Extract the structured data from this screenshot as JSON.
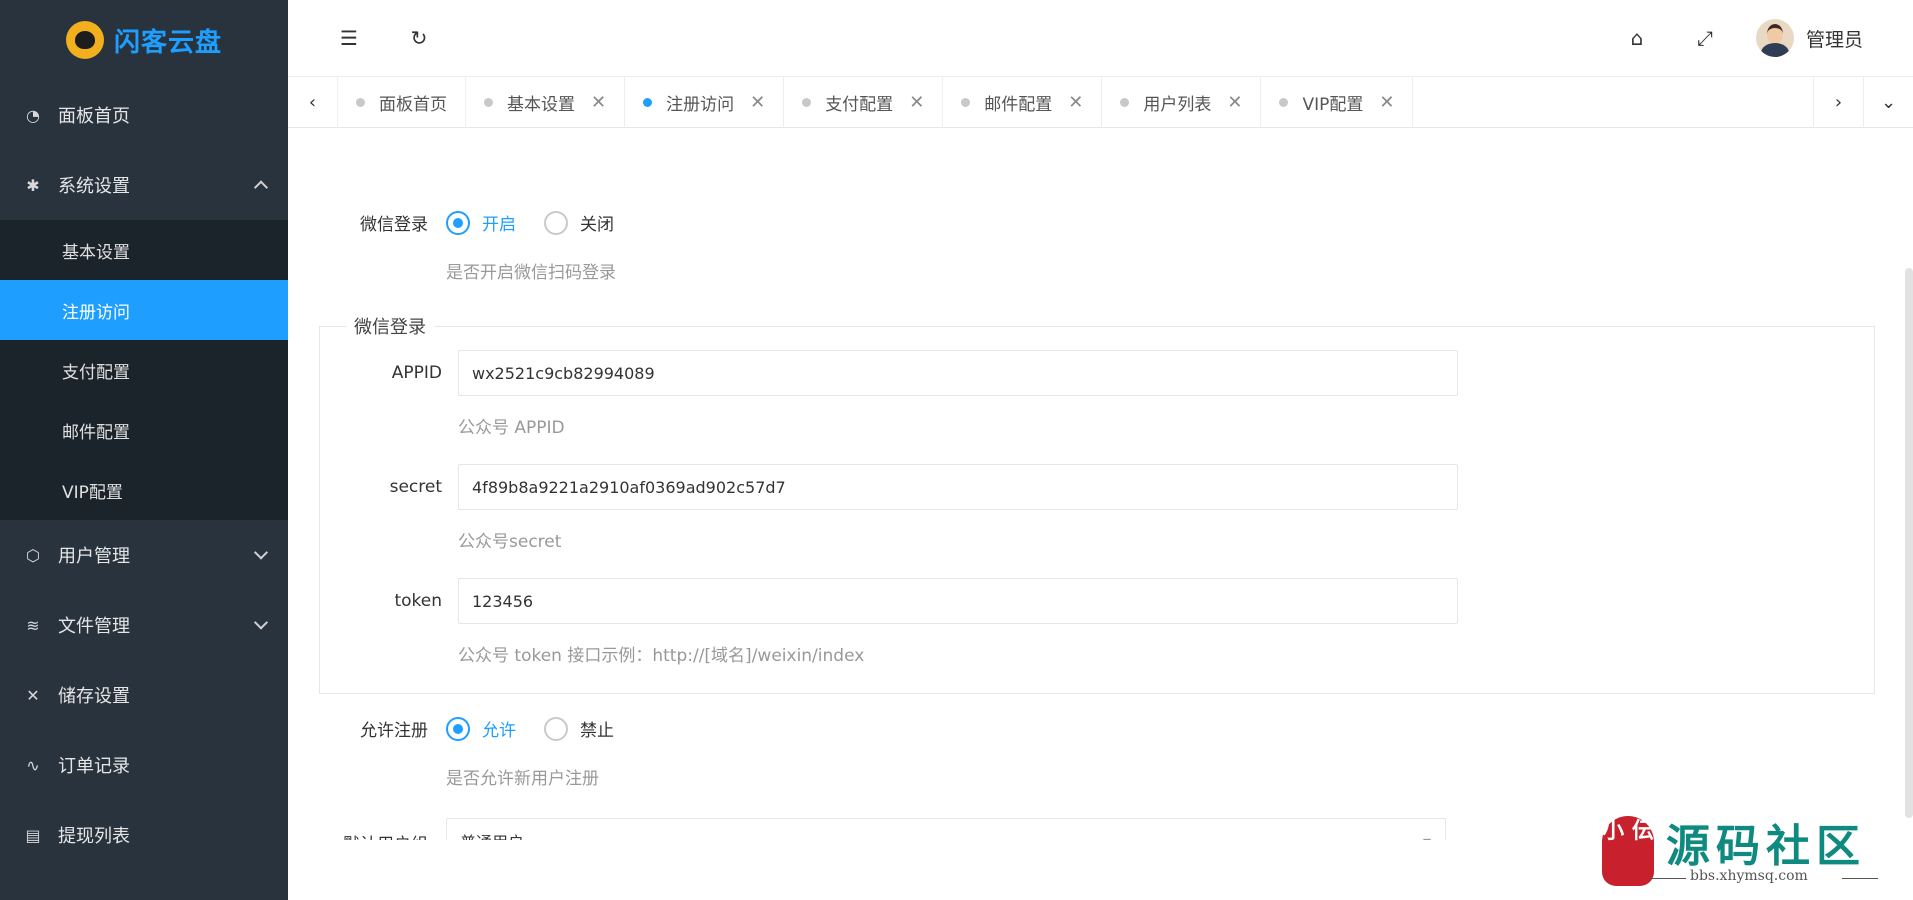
{
  "app": {
    "logo_text": "闪客云盘"
  },
  "sidebar": {
    "items": [
      {
        "label": "面板首页",
        "icon": "gauge-icon"
      },
      {
        "label": "系统设置",
        "icon": "gear-icon"
      },
      {
        "label": "用户管理",
        "icon": "cube-icon"
      },
      {
        "label": "文件管理",
        "icon": "layers-icon"
      },
      {
        "label": "储存设置",
        "icon": "tools-icon"
      },
      {
        "label": "订单记录",
        "icon": "pulse-icon"
      },
      {
        "label": "提现列表",
        "icon": "clipboard-icon"
      }
    ],
    "system_sub": [
      "基本设置",
      "注册访问",
      "支付配置",
      "邮件配置",
      "VIP配置"
    ],
    "active_sub": "注册访问"
  },
  "header": {
    "admin_name": "管理员"
  },
  "tabs": [
    "面板首页",
    "基本设置",
    "注册访问",
    "支付配置",
    "邮件配置",
    "用户列表",
    "VIP配置"
  ],
  "form": {
    "wechat_login": {
      "label": "微信登录",
      "options": [
        "开启",
        "关闭"
      ],
      "selected": "开启",
      "hint": "是否开启微信扫码登录"
    },
    "wechat_section": {
      "legend": "微信登录",
      "appid": {
        "label": "APPID",
        "value": "wx2521c9cb82994089",
        "hint": "公众号 APPID"
      },
      "secret": {
        "label": "secret",
        "value": "4f89b8a9221a2910af0369ad902c57d7",
        "hint": "公众号secret"
      },
      "token": {
        "label": "token",
        "value": "123456",
        "hint": "公众号 token 接口示例：http://[域名]/weixin/index"
      }
    },
    "allow_register": {
      "label": "允许注册",
      "options": [
        "允许",
        "禁止"
      ],
      "selected": "允许",
      "hint": "是否允许新用户注册"
    },
    "default_group": {
      "label": "默认用户组",
      "value": "普通用户"
    }
  },
  "watermark": {
    "seal_text": "小 伝",
    "title": "源码社区",
    "url": "bbs.xhymsq.com"
  },
  "colors": {
    "accent": "#1e9fff",
    "sidebar_bg": "#28333e",
    "submenu_bg": "#1b232b"
  }
}
